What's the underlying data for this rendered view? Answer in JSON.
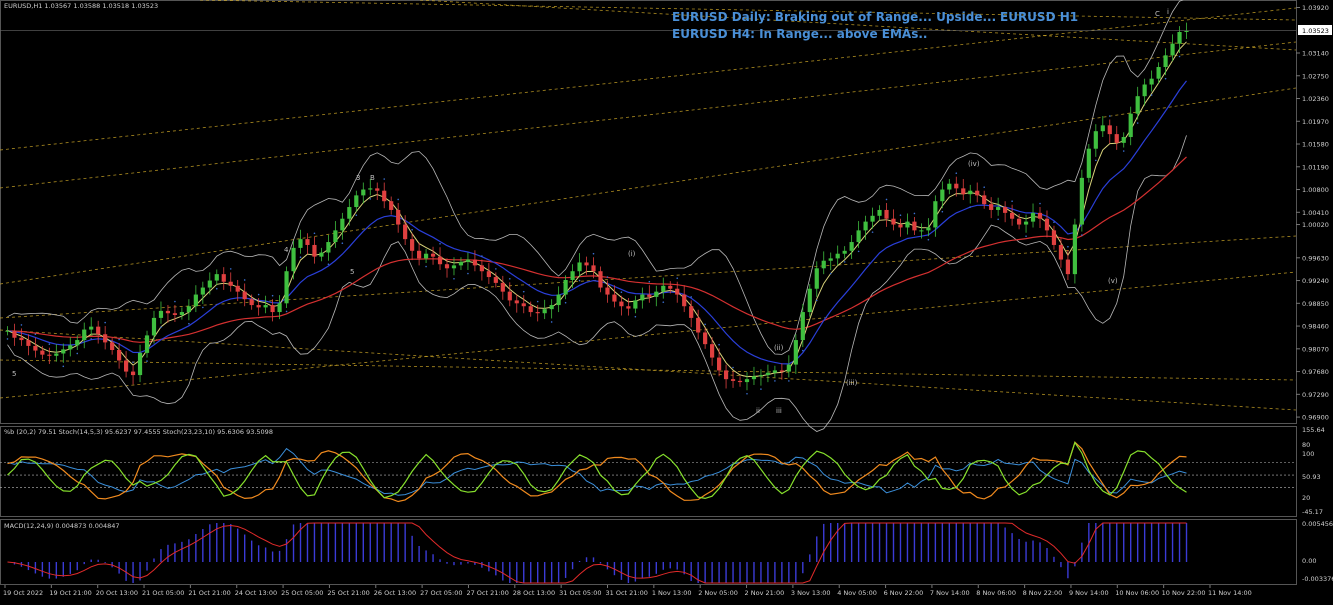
{
  "header": {
    "symbol_ohlc": "EURUSD,H1  1.03567 1.03588 1.03518 1.03523",
    "annotation_1": "EURUSD Daily: Braking out of Range... Upside...",
    "annotation_2": "EURUSD H4: In Range... above EMAs..",
    "annotation_3": "EURUSD H1",
    "current_price_label": "1.03523"
  },
  "indicators": {
    "stoch_header": "%b (20,2) 79.51  Stoch(14,5,3) 95.6237 97.4555  Stoch(23,23,10) 95.6306 93.5098",
    "macd_header": "MACD(12,24,9) 0.004873 0.004847",
    "stoch_axis": [
      "155.64",
      "80",
      "100",
      "50.93",
      "20",
      "-45.17"
    ],
    "macd_axis": [
      "0.005456",
      "0.00",
      "-0.003376"
    ]
  },
  "wave_labels": [
    "5",
    "3",
    "4",
    "5",
    "B",
    "(i)",
    "(ii)",
    "(iii)",
    "(iv)",
    "(v)",
    "C",
    "iii",
    "ii",
    "i"
  ],
  "colors": {
    "bull": "#3fbf3f",
    "bear": "#e04040",
    "ema_red": "#d43030",
    "ema_blue": "#2a3fd9",
    "ema_yellow": "#d8d27a",
    "trend": "#d9b12a",
    "bollinger": "#b8b8b8",
    "stoch_green": "#86e02c",
    "stoch_orange": "#f08a1e",
    "stoch_blue": "#3a8ed9",
    "macd_line": "#e02a2a",
    "macd_hist": "#3b3bd6",
    "title": "#4a8fd6"
  },
  "chart_data": {
    "type": "candlestick",
    "symbol": "EURUSD",
    "timeframe": "H1",
    "ohlc_last": {
      "open": 1.03567,
      "high": 1.03588,
      "low": 1.03518,
      "close": 1.03523
    },
    "y_ticks": [
      1.0392,
      1.03523,
      1.0314,
      1.0275,
      1.0236,
      1.0197,
      1.0158,
      1.0119,
      1.008,
      1.0041,
      1.002,
      0.9963,
      0.9924,
      0.9885,
      0.9846,
      0.9807,
      0.9768,
      0.9729,
      0.969
    ],
    "y_tick_labels": [
      "1.03920",
      "1.03523",
      "1.03140",
      "1.02750",
      "1.02360",
      "1.01970",
      "1.01580",
      "1.01190",
      "1.00800",
      "1.00410",
      "1.00020",
      "0.99630",
      "0.99240",
      "0.98850",
      "0.98460",
      "0.98070",
      "0.97680",
      "0.97290",
      "0.96900"
    ],
    "ylim": [
      0.9685,
      1.0398
    ],
    "x_tick_labels": [
      "19 Oct 2022",
      "19 Oct 21:00",
      "20 Oct 13:00",
      "21 Oct 05:00",
      "21 Oct 21:00",
      "24 Oct 13:00",
      "25 Oct 05:00",
      "25 Oct 21:00",
      "26 Oct 13:00",
      "27 Oct 05:00",
      "27 Oct 21:00",
      "28 Oct 13:00",
      "31 Oct 05:00",
      "31 Oct 21:00",
      "1 Nov 13:00",
      "2 Nov 05:00",
      "2 Nov 21:00",
      "3 Nov 13:00",
      "4 Nov 05:00",
      "6 Nov 22:00",
      "7 Nov 14:00",
      "8 Nov 06:00",
      "8 Nov 22:00",
      "9 Nov 14:00",
      "10 Nov 06:00",
      "10 Nov 22:00",
      "11 Nov 14:00"
    ],
    "series_close": [
      0.9838,
      0.9826,
      0.9822,
      0.9812,
      0.9804,
      0.9797,
      0.9795,
      0.9799,
      0.9806,
      0.9813,
      0.9822,
      0.984,
      0.9845,
      0.9832,
      0.9818,
      0.9805,
      0.9787,
      0.9768,
      0.9762,
      0.98,
      0.983,
      0.986,
      0.9872,
      0.9868,
      0.9865,
      0.987,
      0.988,
      0.99,
      0.9912,
      0.9924,
      0.9935,
      0.9922,
      0.9915,
      0.9905,
      0.9892,
      0.9882,
      0.9878,
      0.9882,
      0.987,
      0.9885,
      0.994,
      0.998,
      0.9995,
      0.9985,
      0.9965,
      0.9972,
      0.999,
      1.001,
      1.003,
      1.005,
      1.007,
      1.008,
      1.0082,
      1.0078,
      1.006,
      1.0045,
      1.002,
      0.9995,
      0.9975,
      0.9962,
      0.997,
      0.9965,
      0.9952,
      0.9945,
      0.995,
      0.9956,
      0.996,
      0.995,
      0.994,
      0.993,
      0.992,
      0.9905,
      0.989,
      0.9885,
      0.988,
      0.987,
      0.9868,
      0.9875,
      0.9882,
      0.99,
      0.9925,
      0.994,
      0.9955,
      0.995,
      0.994,
      0.9912,
      0.99,
      0.9888,
      0.988,
      0.9876,
      0.989,
      0.99,
      0.9896,
      0.9905,
      0.9915,
      0.991,
      0.99,
      0.988,
      0.986,
      0.9835,
      0.9815,
      0.9792,
      0.977,
      0.9755,
      0.9752,
      0.975,
      0.9755,
      0.976,
      0.9762,
      0.9766,
      0.977,
      0.9768,
      0.978,
      0.9822,
      0.987,
      0.991,
      0.9945,
      0.9958,
      0.9962,
      0.997,
      0.9975,
      0.999,
      1.001,
      1.0025,
      1.0035,
      1.0045,
      1.003,
      1.002,
      1.0015,
      1.0025,
      1.001,
      1.001,
      1.0015,
      1.006,
      1.008,
      1.009,
      1.0082,
      1.0072,
      1.0078,
      1.007,
      1.0055,
      1.0045,
      1.005,
      1.004,
      1.003,
      1.002,
      1.0025,
      1.004,
      1.003,
      1.001,
      0.9985,
      0.996,
      0.9935,
      1.002,
      1.01,
      1.015,
      1.018,
      1.019,
      1.0175,
      1.016,
      1.017,
      1.021,
      1.024,
      1.026,
      1.027,
      1.029,
      1.031,
      1.033,
      1.035,
      1.0352
    ]
  }
}
